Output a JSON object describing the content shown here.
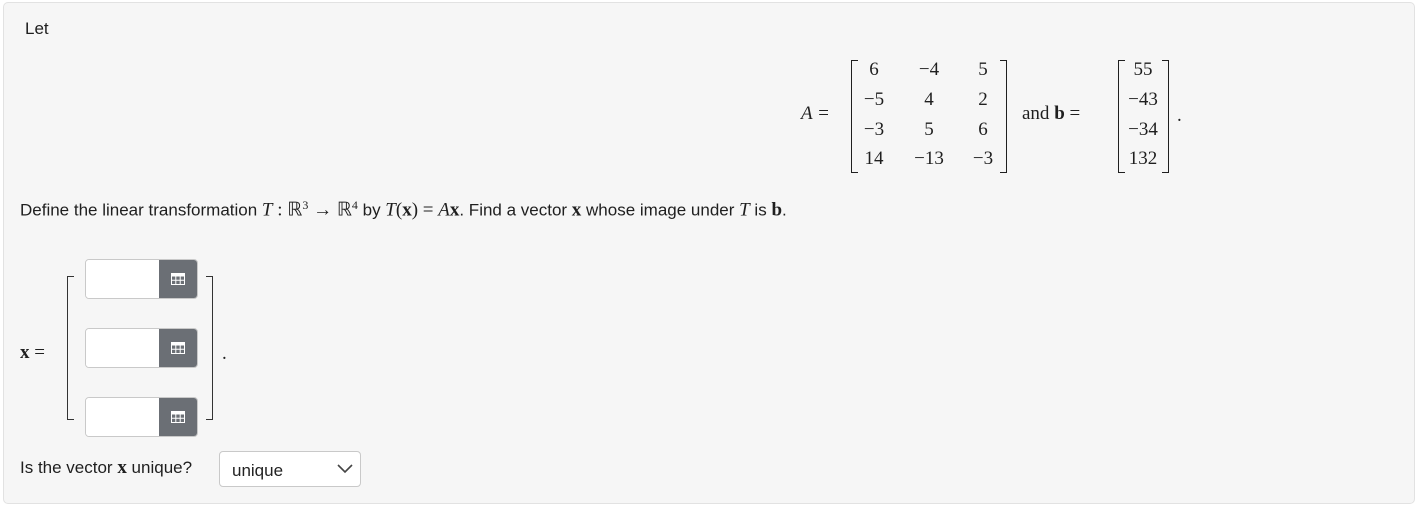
{
  "intro": {
    "let": "Let"
  },
  "matrix_A": {
    "label": "A =",
    "rows": [
      [
        "6",
        "−4",
        "5"
      ],
      [
        "−5",
        "4",
        "2"
      ],
      [
        "−3",
        "5",
        "6"
      ],
      [
        "14",
        "−13",
        "−3"
      ]
    ]
  },
  "and_text": "and",
  "vector_b": {
    "label": "b",
    "eq": "=",
    "rows": [
      "55",
      "−43",
      "−34",
      "132"
    ],
    "period": "."
  },
  "define": {
    "p1": "Define the linear transformation ",
    "T": "T",
    "colon": " : ",
    "R1": "ℝ",
    "exp3": "3",
    "arrow": " → ",
    "R2": "ℝ",
    "exp4": "4",
    "p2": " by ",
    "T2": "T",
    "lp": "(",
    "x": "x",
    "rp": ")",
    "eq": " = ",
    "A": "A",
    "x2": "x",
    "p3": ". Find a vector ",
    "x3": "x",
    "p4": " whose image under ",
    "T3": "T",
    "p5": " is ",
    "b": "b",
    "p6": "."
  },
  "answer": {
    "x_label": "x",
    "eq": "=",
    "period": ".",
    "inputs": [
      {
        "value": "",
        "placeholder": ""
      },
      {
        "value": "",
        "placeholder": ""
      },
      {
        "value": "",
        "placeholder": ""
      }
    ],
    "icon": "matrix-grid-icon"
  },
  "unique": {
    "q1": "Is the vector ",
    "x": "x",
    "q2": " unique?",
    "selected": "unique",
    "icon": "chevron-down-icon"
  },
  "colors": {
    "panel_bg": "#f6f6f6",
    "panel_border": "#e2e2e2",
    "button_bg": "#6b6f75",
    "text": "#1f1f1f"
  }
}
